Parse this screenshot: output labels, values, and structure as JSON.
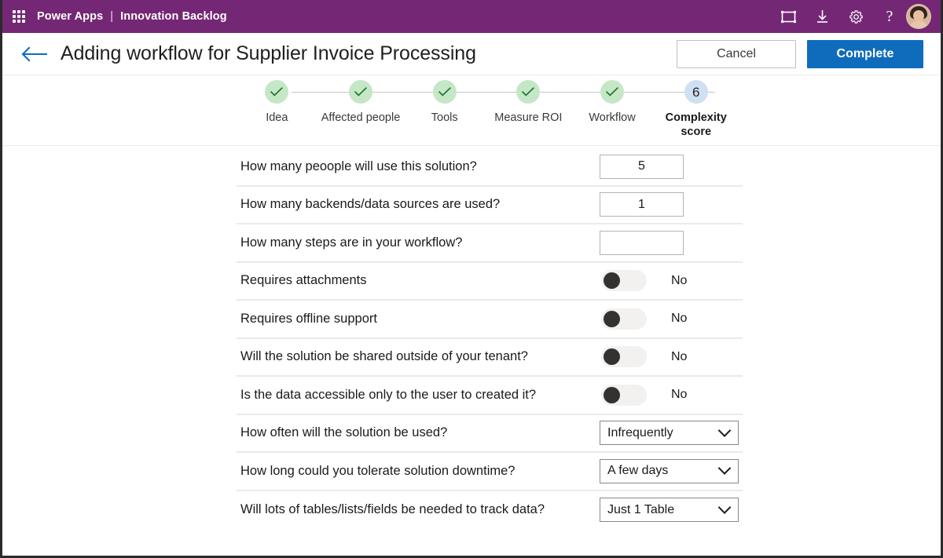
{
  "topbar": {
    "waffle_icon": "app-launcher-icon",
    "brand_product": "Power Apps",
    "brand_separator": "|",
    "brand_app": "Innovation Backlog",
    "icons": [
      {
        "name": "fit-to-screen-icon",
        "label": "Fit to screen"
      },
      {
        "name": "download-icon",
        "label": "Download"
      },
      {
        "name": "gear-icon",
        "label": "Settings"
      },
      {
        "name": "help-icon",
        "label": "?"
      }
    ],
    "avatar_label": "User account"
  },
  "titlebar": {
    "back_label": "Back",
    "title": "Adding workflow for Supplier Invoice Processing",
    "cancel_label": "Cancel",
    "complete_label": "Complete"
  },
  "stepper": {
    "steps": [
      {
        "label": "Idea",
        "state": "complete",
        "marker": "✓"
      },
      {
        "label": "Affected people",
        "state": "complete",
        "marker": "✓"
      },
      {
        "label": "Tools",
        "state": "complete",
        "marker": "✓"
      },
      {
        "label": "Measure ROI",
        "state": "complete",
        "marker": "✓"
      },
      {
        "label": "Workflow",
        "state": "complete",
        "marker": "✓"
      },
      {
        "label": "Complexity score",
        "state": "current",
        "marker": "6"
      }
    ]
  },
  "form": {
    "rows": [
      {
        "type": "number",
        "question": "How many peoople will use this solution?",
        "value": "5",
        "placeholder": ""
      },
      {
        "type": "number",
        "question": "How many backends/data sources are  used?",
        "value": "1",
        "placeholder": ""
      },
      {
        "type": "number",
        "question": "How many steps are in your workflow?",
        "value": "",
        "placeholder": ""
      },
      {
        "type": "toggle",
        "question": "Requires attachments",
        "value": "No",
        "on": false
      },
      {
        "type": "toggle",
        "question": "Requires offline support",
        "value": "No",
        "on": false
      },
      {
        "type": "toggle",
        "question": "Will the solution be shared  outside of your tenant?",
        "value": "No",
        "on": false
      },
      {
        "type": "toggle",
        "question": "Is the data accessible only to the user to created it?",
        "value": "No",
        "on": false
      },
      {
        "type": "dropdown",
        "question": "How often will the solution be used?",
        "value": "Infrequently"
      },
      {
        "type": "dropdown",
        "question": "How long could you tolerate solution downtime?",
        "value": "A few days"
      },
      {
        "type": "dropdown",
        "question": "Will lots of tables/lists/fields be needed to track data?",
        "value": "Just 1 Table"
      }
    ]
  },
  "colors": {
    "brand_purple": "#742774",
    "accent_blue": "#0f6cbd",
    "step_complete": "#c6e7c6",
    "step_current": "#cfe0f2",
    "check_green": "#1e7a34",
    "toggle_knob": "#333231",
    "toggle_track": "#f2f1f0"
  }
}
